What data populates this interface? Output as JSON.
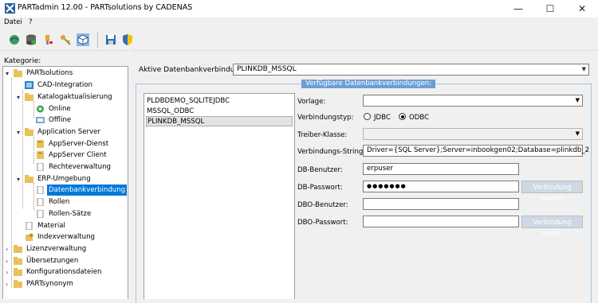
{
  "window": {
    "title": "PARTadmin 12.00 - PARTsolutions by CADENAS",
    "minimize_glyph": "—",
    "maximize_glyph": "☐",
    "close_glyph": "✕"
  },
  "menu": {
    "items": [
      "Datei",
      "?"
    ]
  },
  "toolbar": {
    "icons": [
      "green-sphere-icon",
      "database-stack-icon",
      "usb-key-icon",
      "keys-icon",
      "cube-icon",
      "save-icon",
      "shield-icon"
    ]
  },
  "left": {
    "label": "Kategorie:",
    "tree": [
      {
        "label": "PARTsolutions"
      },
      {
        "label": "CAD-Integration"
      },
      {
        "label": "Katalogaktualisierung"
      },
      {
        "label": "Online"
      },
      {
        "label": "Offline"
      },
      {
        "label": "Application Server"
      },
      {
        "label": "AppServer-Dienst"
      },
      {
        "label": "AppServer Client"
      },
      {
        "label": "Rechteverwaltung"
      },
      {
        "label": "ERP-Umgebung"
      },
      {
        "label": "Datenbankverbindung"
      },
      {
        "label": "Rollen"
      },
      {
        "label": "Rollen-Sätze"
      },
      {
        "label": "Material"
      },
      {
        "label": "Indexverwaltung"
      },
      {
        "label": "Lizenzverwaltung"
      },
      {
        "label": "Übersetzungen"
      },
      {
        "label": "Konfigurationsdateien"
      },
      {
        "label": "PARTsynonym"
      }
    ]
  },
  "right": {
    "active_label": "Aktive Datenbankverbindung:",
    "active_value": "PLINKDB_MSSQL",
    "group_title": "Verfügbare Datenbankverbindungen:",
    "connections": [
      "PLDBDEMO_SQLITEJDBC",
      "MSSQL_ODBC",
      "PLINKDB_MSSQL"
    ],
    "form": {
      "vorlage_label": "Vorlage:",
      "vorlage_value": "",
      "verbindungstyp_label": "Verbindungstyp:",
      "jdbc_label": "JDBC",
      "odbc_label": "ODBC",
      "selected_type": "ODBC",
      "treiber_label": "Treiber-Klasse:",
      "treiber_value": "",
      "verbindungsstring_label": "Verbindungs-String:",
      "verbindungsstring_value": "Driver={SQL Server};Server=inbookgen02;Database=plinkdb_2",
      "db_benutzer_label": "DB-Benutzer:",
      "db_benutzer_value": "erpuser",
      "db_passwort_label": "DB-Passwort:",
      "db_passwort_value": "●●●●●●●",
      "test_button": "Verbindung testen",
      "dbo_benutzer_label": "DBO-Benutzer:",
      "dbo_benutzer_value": "",
      "dbo_passwort_label": "DBO-Passwort:",
      "dbo_passwort_value": "",
      "test_button2": "Verbindung testen"
    }
  },
  "colors": {
    "selection": "#0078d7",
    "group_title_bg": "#6d9ed6",
    "folder": "#e8c15a"
  }
}
